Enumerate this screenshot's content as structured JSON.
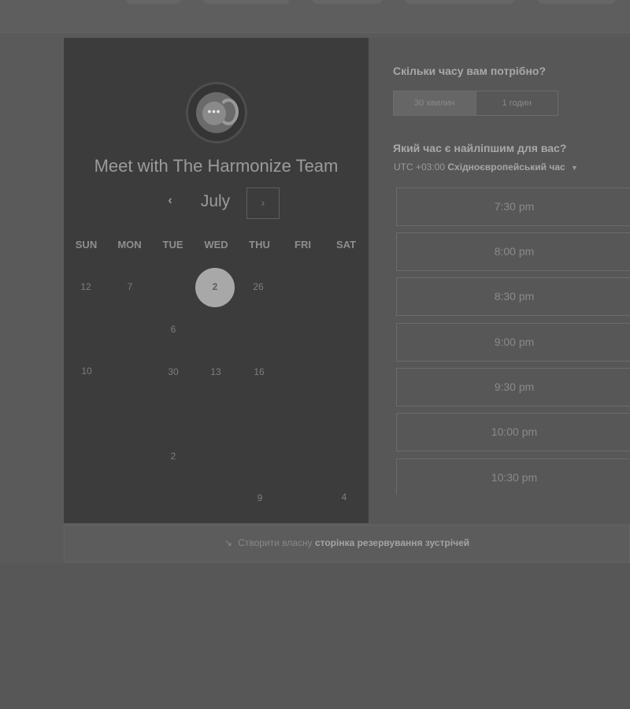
{
  "meeting": {
    "title": "Meet with The Harmonize Team"
  },
  "calendar": {
    "month": "July",
    "prev_icon": "‹",
    "next_icon": "›",
    "weekdays": [
      "SUN",
      "MON",
      "TUE",
      "WED",
      "THU",
      "FRI",
      "SAT"
    ],
    "days": [
      "12",
      "7",
      "2",
      "26",
      "6",
      "10",
      "30",
      "13",
      "16",
      "2",
      "9",
      "4"
    ],
    "selected_day": "2"
  },
  "duration": {
    "question": "Скільки часу вам потрібно?",
    "options": [
      "30 хвилин",
      "1 годин"
    ],
    "selected": "30 хвилин"
  },
  "time": {
    "question": "Який час є найліпшим для вас?",
    "timezone_offset": "UTC +03:00",
    "timezone_name": "Східноєвропейський час",
    "slots": [
      "7:30 pm",
      "8:00 pm",
      "8:30 pm",
      "9:00 pm",
      "9:30 pm",
      "10:00 pm",
      "10:30 pm"
    ]
  },
  "footer": {
    "prefix": "Створити власну",
    "link": "сторінка резервування зустрічей"
  },
  "icons": {
    "logo": "chat-bubble-logo",
    "prev": "chevron-left-icon",
    "next": "chevron-right-icon",
    "timezone_caret": "caret-down-icon",
    "footer": "pointer-icon"
  }
}
